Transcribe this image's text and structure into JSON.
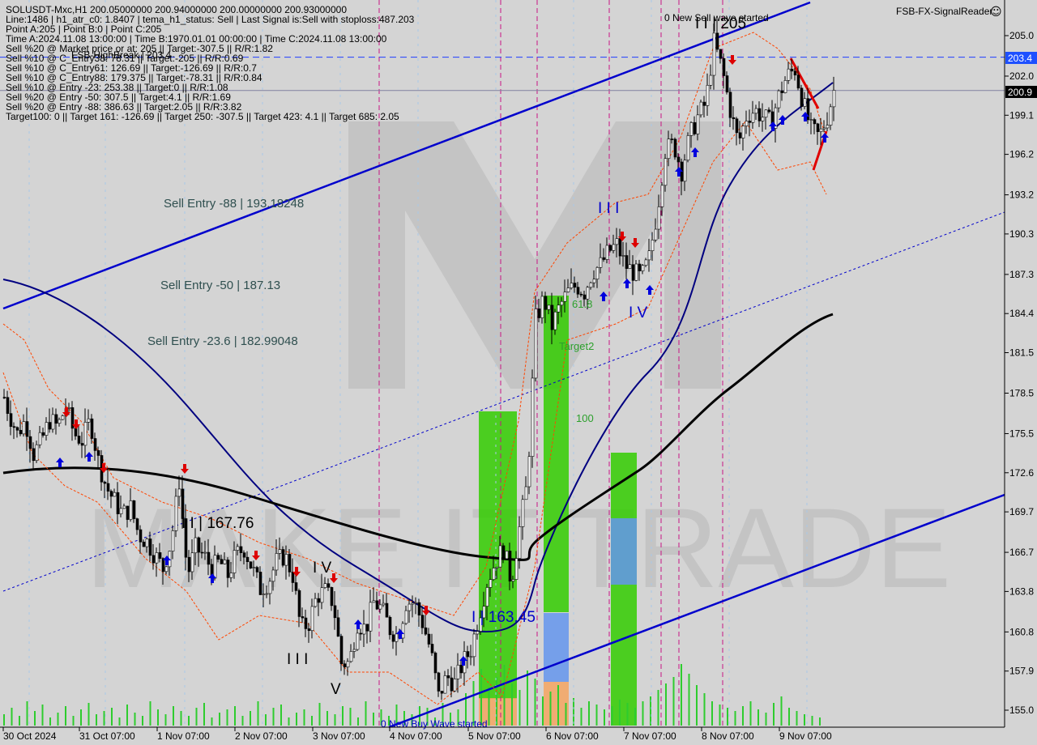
{
  "header": {
    "lines": [
      "SOLUSDT-Mxc,H1  200.05000000 200.94000000 200.00000000 200.93000000",
      "Line:1486 | h1_atr_c0: 1.8407 | tema_h1_status: Sell | Last Signal is:Sell with stoploss:487.203",
      "Point A:205 | Point B:0 | Point C:205",
      "Time A:2024.11.08 13:00:00 | Time B:1970.01.01 00:00:00 | Time C:2024.11.08 13:00:00",
      "Sell %20 @ Market price or at: 205 || Target:-307.5 || R/R:1.82",
      "Sell %10 @ C_Entry38: 78.31 || Target:-205 || R/R:0.69",
      "Sell %10 @ C_Entry61: 126.69 || Target:-126.69 || R/R:0.7",
      "Sell %10 @ C_Entry88: 179.375 || Target:-78.31 || R/R:0.84",
      "Sell %10 @ Entry -23: 253.38 || Target:0 || R/R:1.08",
      "Sell %20 @ Entry -50: 307.5 || Target:4.1 || R/R:1.69",
      "Sell %20 @ Entry -88: 386.63 || Target:2.05 || R/R:3.82",
      "Target100: 0 || Target 161: -126.69 || Target 250: -307.5 || Target 423: 4.1 || Target 685: 2.05"
    ],
    "overlap_text": "FSB-HighBreak | 203.4",
    "signal_reader": "FSB-FX-SignalReader",
    "smiley": "☺"
  },
  "watermark": "MAKE IT TRADE",
  "annotations": {
    "sell_entry_88": "Sell Entry -88 | 193.18248",
    "sell_entry_50": "Sell Entry -50 | 187.13",
    "sell_entry_23": "Sell Entry -23.6 | 182.99048",
    "wave_ii": "I I | 167.76",
    "wave_iv_left": "I V",
    "wave_iii_left": "I I I",
    "wave_v_left": "V",
    "wave_i_low": "I | 163.45",
    "wave_iii_mid": "I I I",
    "wave_iv_mid": "I V",
    "wave_top": "I I | 205",
    "new_sell_wave": "0 New Sell wave started",
    "new_buy_wave": "0 New Buy Wave started",
    "label_618": "61.8",
    "label_target2": "Target2",
    "label_100": "100"
  },
  "price_tags": {
    "level_203": "203.4",
    "level_current": "200.9"
  },
  "chart_data": {
    "type": "candlestick",
    "symbol": "SOLUSDT-Mxc",
    "timeframe": "H1",
    "ylim": [
      154.5,
      207.0
    ],
    "y_ticks": [
      "205.0",
      "202.0",
      "199.1",
      "196.2",
      "193.2",
      "190.3",
      "187.3",
      "184.4",
      "181.5",
      "178.5",
      "175.5",
      "172.6",
      "169.7",
      "166.7",
      "163.8",
      "160.8",
      "157.9",
      "155.0"
    ],
    "x_ticks": [
      "30 Oct 2024",
      "31 Oct 07:00",
      "1 Nov 07:00",
      "2 Nov 07:00",
      "3 Nov 07:00",
      "4 Nov 07:00",
      "5 Nov 07:00",
      "6 Nov 07:00",
      "7 Nov 07:00",
      "8 Nov 07:00",
      "9 Nov 07:00"
    ],
    "close_path": [
      [
        0,
        179.0
      ],
      [
        10,
        177.0
      ],
      [
        20,
        175.5
      ],
      [
        30,
        176.5
      ],
      [
        40,
        174.0
      ],
      [
        50,
        175.0
      ],
      [
        60,
        176.5
      ],
      [
        70,
        176.0
      ],
      [
        80,
        177.5
      ],
      [
        90,
        175.5
      ],
      [
        100,
        175.0
      ],
      [
        110,
        176.5
      ],
      [
        120,
        173.5
      ],
      [
        130,
        171.5
      ],
      [
        140,
        170.5
      ],
      [
        150,
        169.5
      ],
      [
        160,
        170.0
      ],
      [
        170,
        168.0
      ],
      [
        180,
        167.5
      ],
      [
        190,
        166.5
      ],
      [
        200,
        165.5
      ],
      [
        210,
        167.5
      ],
      [
        220,
        172.0
      ],
      [
        230,
        165.0
      ],
      [
        240,
        167.0
      ],
      [
        250,
        166.5
      ],
      [
        260,
        165.5
      ],
      [
        270,
        166.0
      ],
      [
        280,
        165.0
      ],
      [
        290,
        166.5
      ],
      [
        300,
        167.0
      ],
      [
        310,
        165.5
      ],
      [
        320,
        164.0
      ],
      [
        330,
        164.5
      ],
      [
        340,
        166.0
      ],
      [
        350,
        166.5
      ],
      [
        360,
        165.0
      ],
      [
        370,
        161.0
      ],
      [
        380,
        161.5
      ],
      [
        390,
        163.5
      ],
      [
        400,
        163.8
      ],
      [
        410,
        163.0
      ],
      [
        420,
        158.5
      ],
      [
        430,
        158.5
      ],
      [
        440,
        161.5
      ],
      [
        450,
        161.0
      ],
      [
        460,
        163.0
      ],
      [
        470,
        162.5
      ],
      [
        480,
        161.0
      ],
      [
        490,
        160.5
      ],
      [
        500,
        163.0
      ],
      [
        510,
        163.0
      ],
      [
        520,
        161.5
      ],
      [
        530,
        159.5
      ],
      [
        540,
        156.0
      ],
      [
        550,
        157.5
      ],
      [
        560,
        157.0
      ],
      [
        570,
        158.5
      ],
      [
        580,
        159.5
      ],
      [
        590,
        162.0
      ],
      [
        600,
        164.5
      ],
      [
        610,
        166.0
      ],
      [
        620,
        167.0
      ],
      [
        630,
        164.5
      ],
      [
        640,
        168.5
      ],
      [
        650,
        172.0
      ],
      [
        660,
        184.0
      ],
      [
        670,
        185.5
      ],
      [
        680,
        183.5
      ],
      [
        690,
        185.0
      ],
      [
        700,
        186.0
      ],
      [
        710,
        186.5
      ],
      [
        720,
        186.0
      ],
      [
        730,
        187.5
      ],
      [
        740,
        188.0
      ],
      [
        750,
        189.0
      ],
      [
        760,
        189.5
      ],
      [
        770,
        188.0
      ],
      [
        780,
        187.5
      ],
      [
        790,
        187.0
      ],
      [
        800,
        188.5
      ],
      [
        810,
        192.0
      ],
      [
        820,
        196.5
      ],
      [
        830,
        197.0
      ],
      [
        840,
        195.0
      ],
      [
        850,
        197.5
      ],
      [
        860,
        199.0
      ],
      [
        870,
        200.0
      ],
      [
        880,
        204.5
      ],
      [
        890,
        202.5
      ],
      [
        900,
        199.5
      ],
      [
        910,
        197.0
      ],
      [
        920,
        199.0
      ],
      [
        930,
        199.5
      ],
      [
        940,
        199.0
      ],
      [
        950,
        198.5
      ],
      [
        960,
        200.5
      ],
      [
        970,
        202.0
      ],
      [
        980,
        202.5
      ],
      [
        990,
        200.0
      ],
      [
        1000,
        198.0
      ],
      [
        1010,
        197.5
      ],
      [
        1020,
        199.0
      ],
      [
        1028,
        200.93
      ]
    ],
    "volume_bars": [
      14,
      22,
      12,
      30,
      18,
      26,
      10,
      16,
      24,
      12,
      20,
      28,
      14,
      18,
      22,
      10,
      26,
      16,
      12,
      30,
      20,
      14,
      24,
      18,
      12,
      22,
      28,
      10,
      16,
      20,
      24,
      12,
      18,
      30,
      14,
      22,
      26,
      10,
      16,
      20,
      12,
      28,
      18,
      14,
      24,
      22,
      10,
      30,
      16,
      20,
      12,
      26,
      18,
      14,
      24,
      22,
      10,
      28,
      16,
      20,
      40,
      55,
      70,
      48,
      60,
      75,
      52,
      44,
      68,
      58,
      36,
      42,
      50,
      28,
      34,
      22,
      30,
      26,
      20,
      24,
      32,
      28,
      22,
      30,
      36,
      44,
      52,
      60,
      76,
      64,
      50,
      40,
      30,
      26,
      22,
      18,
      24,
      30,
      20,
      16,
      28,
      36,
      22,
      18,
      14,
      12,
      10
    ],
    "colors": {
      "background": "#d4d4d4",
      "bull_candle": "#000000",
      "bear_candle": "#000000",
      "channel": "#0000cc",
      "ma_fast": "#000080",
      "ma_slow": "#000000",
      "envelope": "#ff4500",
      "zone_green": "#33cc00",
      "zone_blue": "#6495ed",
      "zone_orange": "#f4a460",
      "vline": "#c71585",
      "hline_dash": "#0000cc",
      "sell_arrow": "#dd0000",
      "buy_arrow": "#0000dd",
      "volume": "#2ecc2e"
    }
  }
}
